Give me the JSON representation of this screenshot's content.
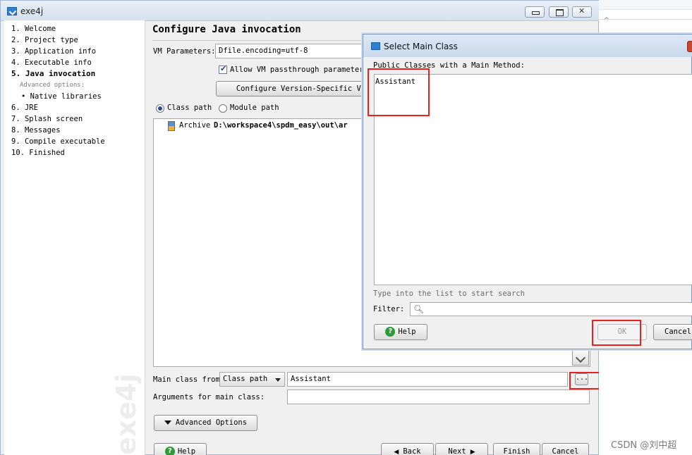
{
  "window": {
    "title": "exe4j"
  },
  "sidebar": {
    "items": [
      {
        "label": "1.  Welcome"
      },
      {
        "label": "2.  Project type"
      },
      {
        "label": "3.  Application info"
      },
      {
        "label": "4.  Executable info"
      },
      {
        "label": "5.  Java invocation"
      },
      {
        "label": "Advanced options:"
      },
      {
        "label": "• Native libraries"
      },
      {
        "label": "6.  JRE"
      },
      {
        "label": "7.  Splash screen"
      },
      {
        "label": "8.  Messages"
      },
      {
        "label": "9.  Compile executable"
      },
      {
        "label": "10.  Finished"
      }
    ],
    "watermark": "exe4j"
  },
  "main": {
    "title": "Configure Java invocation",
    "vm_params_label": "VM Parameters:",
    "vm_params_value": "Dfile.encoding=utf-8",
    "allow_passthrough_label": "Allow VM passthrough parameters",
    "configure_version_button": "Configure Version-Specific VM Pa",
    "classpath_radio_label": "Class path",
    "modulepath_radio_label": "Module path",
    "archive_label": "Archive",
    "archive_path": "D:\\workspace4\\spdm_easy\\out\\ar",
    "main_class_from_label": "Main class from",
    "main_class_source": "Class path",
    "main_class_value": "Assistant",
    "browse_button": "...",
    "arguments_label": "Arguments for main class:",
    "arguments_value": "",
    "advanced_options_button": "Advanced Options",
    "help_button": "Help",
    "back_button": "Back",
    "next_button": "Next",
    "finish_button": "Finish",
    "cancel_button": "Cancel"
  },
  "dialog": {
    "title": "Select Main Class",
    "list_label": "Public Classes with a Main Method:",
    "classes": [
      "Assistant"
    ],
    "search_hint": "Type into the list to start search",
    "filter_label": "Filter:",
    "filter_value": "",
    "help_button": "Help",
    "ok_button": "OK",
    "cancel_button": "Cancel"
  },
  "credit": "CSDN @刘中超",
  "colors": {
    "highlight": "#e8211f",
    "titlebar": "#d6e1ee"
  }
}
